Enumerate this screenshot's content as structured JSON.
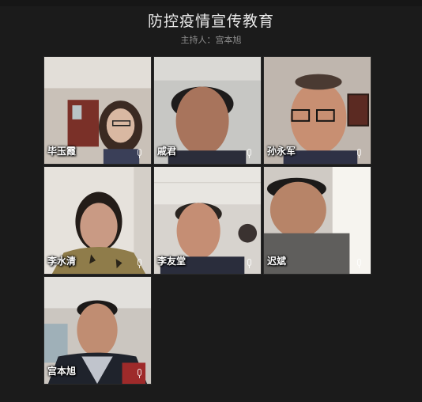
{
  "meeting": {
    "title": "防控疫情宣传教育",
    "host_line": "主持人：宫本旭"
  },
  "participants": [
    {
      "name": "毕玉霞",
      "mic": "mic-icon"
    },
    {
      "name": "戚君",
      "mic": "mic-icon"
    },
    {
      "name": "孙永军",
      "mic": "mic-icon"
    },
    {
      "name": "李水清",
      "mic": "mic-icon"
    },
    {
      "name": "李友堂",
      "mic": "mic-icon"
    },
    {
      "name": "迟斌",
      "mic": "mic-icon"
    },
    {
      "name": "宫本旭",
      "mic": "mic-icon"
    }
  ],
  "colors": {
    "background": "#1b1b1b",
    "title": "#e9e9e9",
    "subtitle": "#8f8f8f"
  }
}
